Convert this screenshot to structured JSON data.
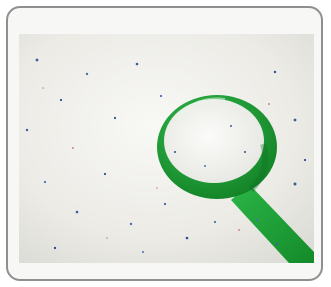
{
  "image": {
    "subject": "detergent-powder-with-green-scoop",
    "colors": {
      "card_border": "#8f8f8f",
      "card_background": "#f7f7f5",
      "powder": "#efeee9",
      "speck_blue": "#3a5d9f",
      "scoop_green": "#20a23a",
      "scoop_dark": "#137a26"
    }
  }
}
